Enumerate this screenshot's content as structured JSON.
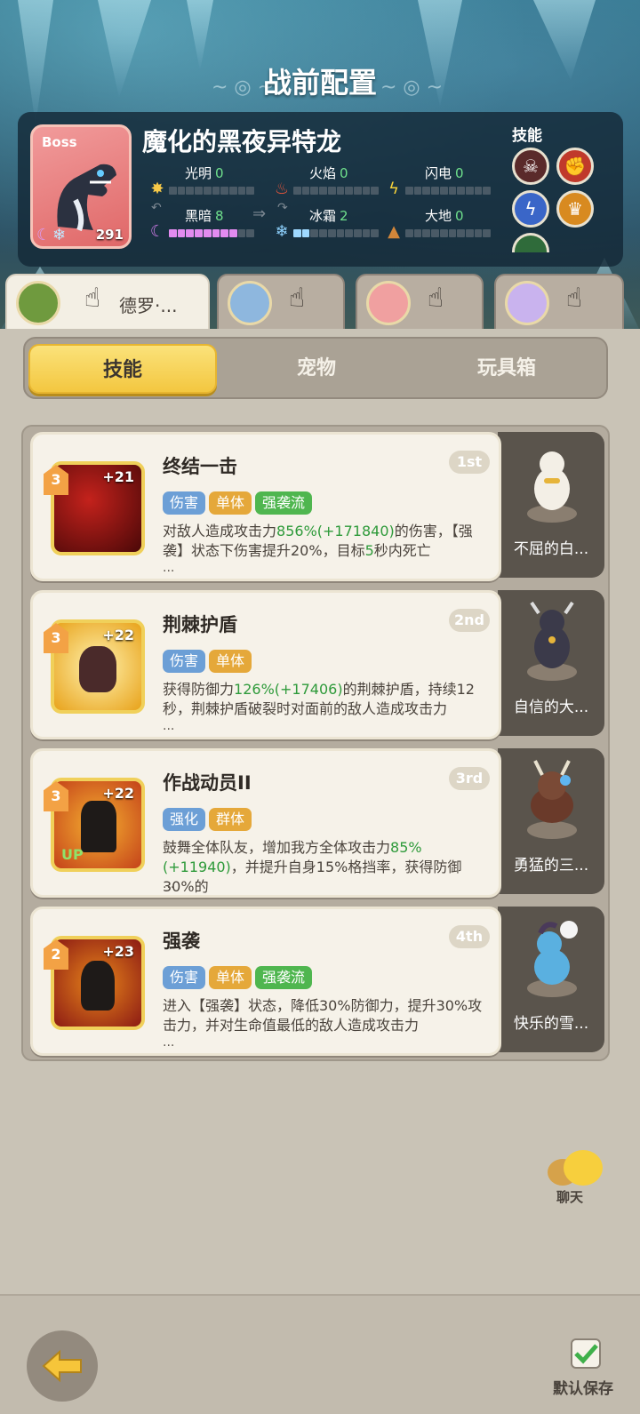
{
  "screen": {
    "title": "战前配置"
  },
  "boss": {
    "badge": "Boss",
    "level": "291",
    "name": "魔化的黑夜异特龙",
    "stats": [
      {
        "name": "光明",
        "value": "0",
        "level": 0,
        "icon": "sun-icon"
      },
      {
        "name": "火焰",
        "value": "0",
        "level": 0,
        "icon": "fire-icon"
      },
      {
        "name": "闪电",
        "value": "0",
        "level": 0,
        "icon": "lightning-icon"
      },
      {
        "name": "黑暗",
        "value": "8",
        "level": 8,
        "icon": "moon-icon"
      },
      {
        "name": "冰霜",
        "value": "2",
        "level": 2,
        "icon": "snowflake-icon"
      },
      {
        "name": "大地",
        "value": "0",
        "level": 0,
        "icon": "mountain-icon"
      }
    ],
    "skills_label": "技能"
  },
  "heroes": [
    {
      "name": "德罗·...",
      "active": true
    },
    {
      "name": "",
      "active": false
    },
    {
      "name": "",
      "active": false
    },
    {
      "name": "",
      "active": false
    }
  ],
  "tabs": {
    "skills": "技能",
    "pets": "宠物",
    "toybox": "玩具箱",
    "active": "skills"
  },
  "skills": [
    {
      "name": "终结一击",
      "rank": "1st",
      "level": "3",
      "plus": "+21",
      "tags": [
        "伤害",
        "单体",
        "强袭流"
      ],
      "desc": [
        {
          "t": "对敌人造成攻击力"
        },
        {
          "t": "856",
          "hl": true
        },
        {
          "t": "%(+171840)",
          "hl": true
        },
        {
          "t": "的伤害，【强袭】状态下伤害提升20%，目标"
        },
        {
          "t": "5",
          "hl": true
        },
        {
          "t": "秒内死亡"
        }
      ],
      "more": "...",
      "pet": "不屈的白..."
    },
    {
      "name": "荆棘护盾",
      "rank": "2nd",
      "level": "3",
      "plus": "+22",
      "tags": [
        "伤害",
        "单体"
      ],
      "desc": [
        {
          "t": "获得防御力"
        },
        {
          "t": "126",
          "hl": true
        },
        {
          "t": "%(+17406)",
          "hl": true
        },
        {
          "t": "的荆棘护盾，持续12秒，荆棘护盾破裂时对面前的敌人造成攻击力"
        }
      ],
      "more": "...",
      "pet": "自信的大..."
    },
    {
      "name": "作战动员II",
      "rank": "3rd",
      "level": "3",
      "plus": "+22",
      "tags": [
        "强化",
        "群体"
      ],
      "desc": [
        {
          "t": "鼓舞全体队友，增加我方全体攻击力"
        },
        {
          "t": "85",
          "hl": true
        },
        {
          "t": "%(+11940)",
          "hl": true
        },
        {
          "t": "，并提升自身15%格挡率，获得防御30%的"
        }
      ],
      "more": "...",
      "pet": "勇猛的三..."
    },
    {
      "name": "强袭",
      "rank": "4th",
      "level": "2",
      "plus": "+23",
      "tags": [
        "伤害",
        "单体",
        "强袭流"
      ],
      "desc": [
        {
          "t": "进入【强袭】状态，降低30%防御力，提升30%攻击力，并对生命值最低的敌人造成攻击力"
        }
      ],
      "more": "...",
      "pet": "快乐的雪..."
    }
  ],
  "chat": {
    "label": "聊天"
  },
  "footer": {
    "save_label": "默认保存"
  },
  "colors": {
    "accent": "#f3c740",
    "highlight": "#2e9a3a",
    "tag_blue": "#6c9fd6",
    "tag_orange": "#e5a83a",
    "tag_green": "#4fb64f"
  }
}
